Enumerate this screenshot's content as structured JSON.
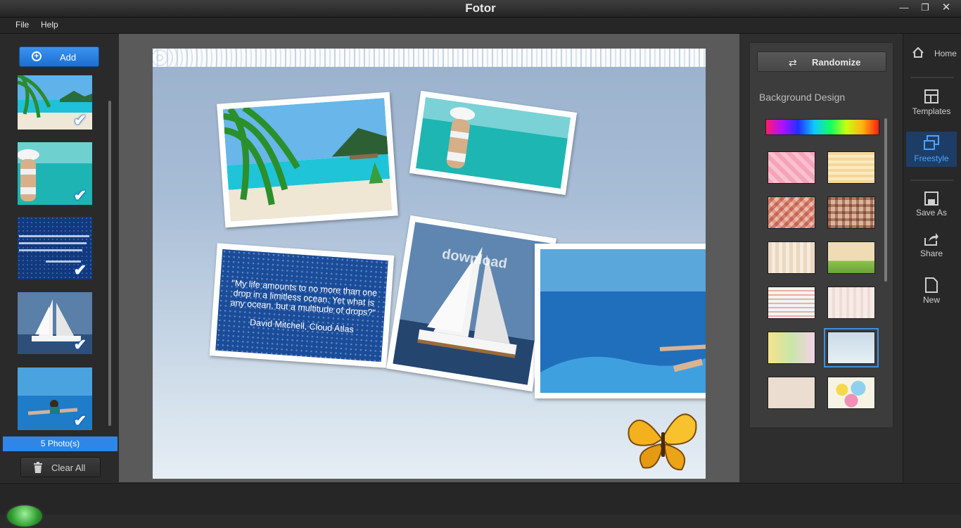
{
  "window": {
    "title": "Fotor",
    "controls": [
      "minimize",
      "restore",
      "close"
    ]
  },
  "menu": {
    "file": "File",
    "help": "Help"
  },
  "left": {
    "add_label": "Add",
    "photos": [
      {
        "name": "beach-palm",
        "selected": true
      },
      {
        "name": "woman-hat",
        "selected": true
      },
      {
        "name": "quote-ocean",
        "selected": true
      },
      {
        "name": "sailboat",
        "selected": true
      },
      {
        "name": "swimmer-pool",
        "selected": true
      }
    ],
    "count_label": "5 Photo(s)",
    "clear_label": "Clear All"
  },
  "canvas": {
    "quote_text": "\"My life amounts to no more than one drop in a limitless ocean. Yet what is any ocean, but a multitude of drops?\"",
    "quote_author": "David Mitchell, Cloud Atlas",
    "watermark": "download"
  },
  "right": {
    "randomize_label": "Randomize",
    "background_title": "Background Design",
    "swatches": [
      "pink-pattern",
      "yellow-stripes-note",
      "red-plaid",
      "brown-plaid",
      "beige-stripes",
      "beige-landscape",
      "bear-stripes",
      "cream-stripes",
      "pastel-hearts",
      "blue-butterfly",
      "plain-beige",
      "colorful-circles"
    ],
    "selected_swatch": "blue-butterfly"
  },
  "sidebar": {
    "home": "Home",
    "templates": "Templates",
    "freestyle": "Freestyle",
    "save_as": "Save As",
    "share": "Share",
    "new": "New",
    "active": "freestyle"
  },
  "colors": {
    "accent": "#2d86e8",
    "active_bg": "#1e3d66",
    "active_text": "#4ea3ff"
  }
}
